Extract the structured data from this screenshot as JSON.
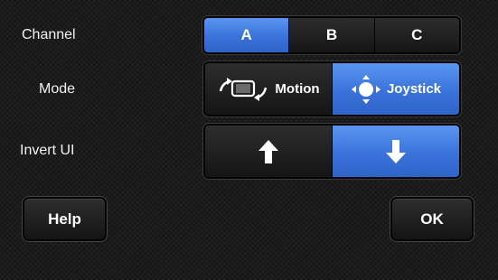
{
  "labels": {
    "channel": "Channel",
    "mode": "Mode",
    "invert_ui": "Invert UI"
  },
  "channel": {
    "options": [
      "A",
      "B",
      "C"
    ],
    "selected": "A"
  },
  "mode": {
    "options": [
      {
        "label": "Motion",
        "icon": "rotate-phone-icon"
      },
      {
        "label": "Joystick",
        "icon": "joystick-icon"
      }
    ],
    "selected": "Joystick"
  },
  "invert": {
    "options": [
      {
        "icon": "arrow-up-icon"
      },
      {
        "icon": "arrow-down-icon"
      }
    ],
    "selected": "arrow-down-icon"
  },
  "buttons": {
    "help": "Help",
    "ok": "OK"
  },
  "colors": {
    "accent": "#3a72db",
    "background": "#1b1b1b",
    "text": "#ffffff"
  }
}
